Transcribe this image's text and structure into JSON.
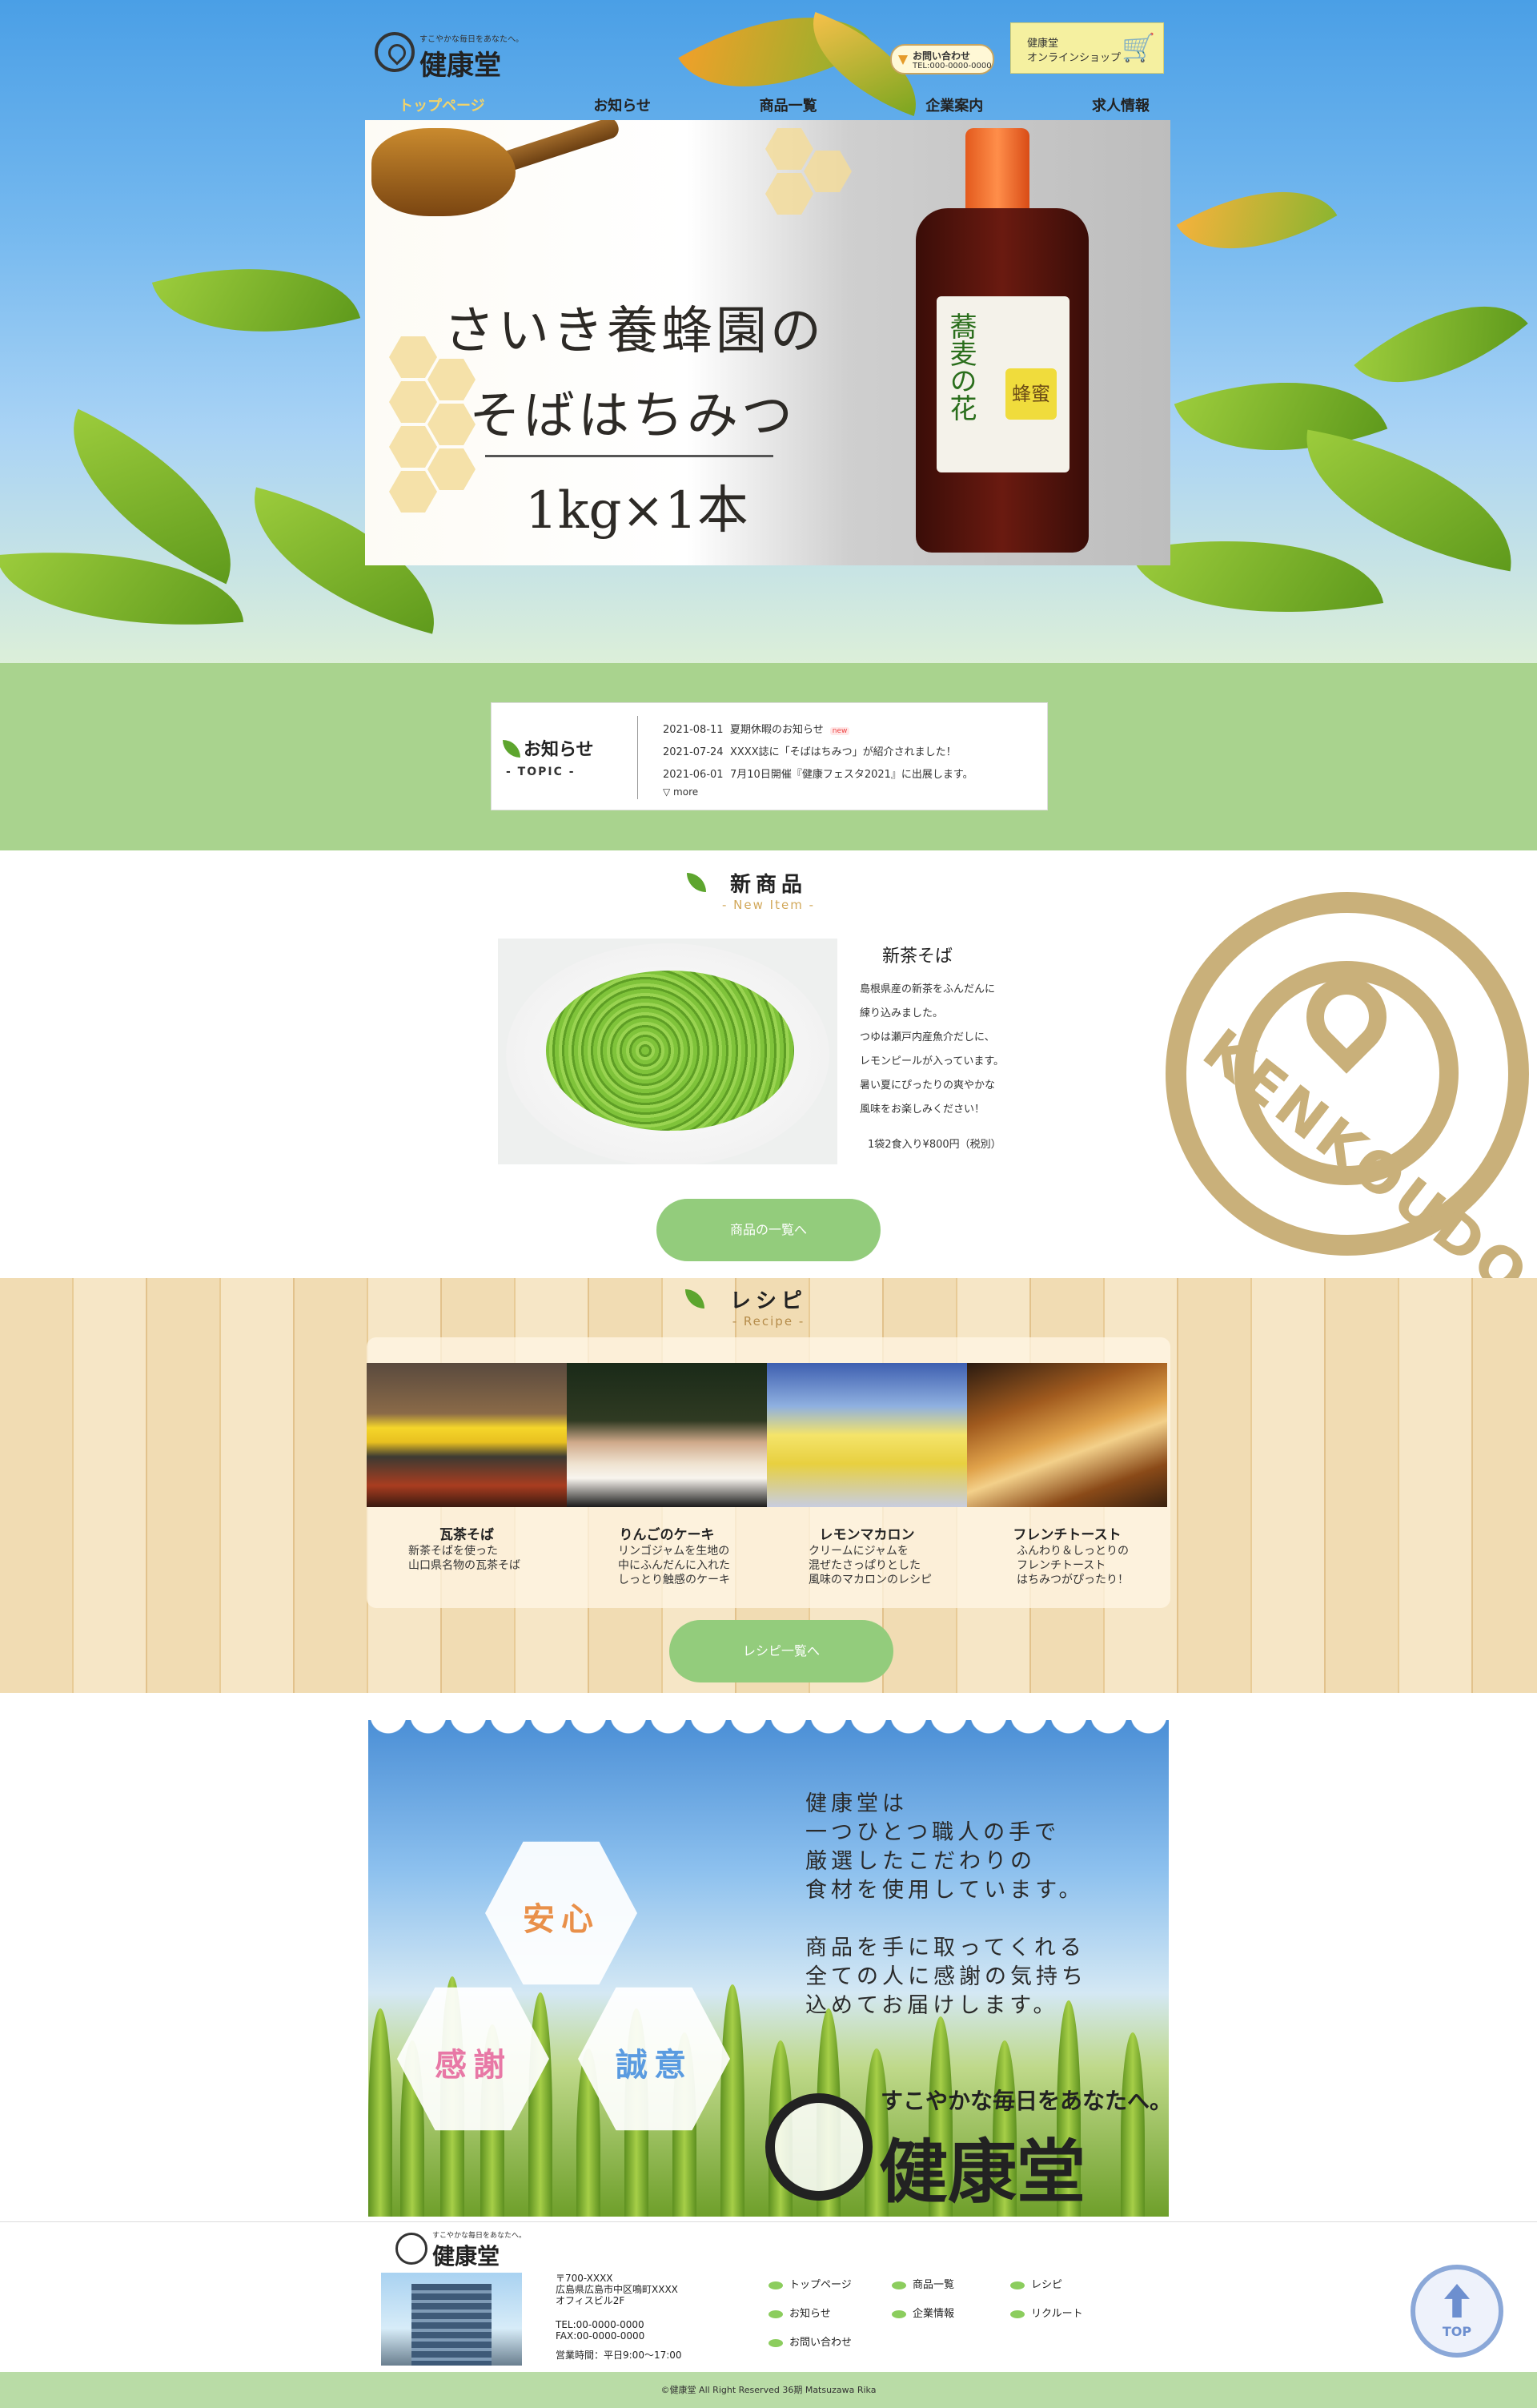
{
  "header": {
    "logo_tagline": "すこやかな毎日をあなたへ。",
    "logo_name": "健康堂",
    "contact_line1": "お問い合わせ",
    "contact_line2": "TEL:000-0000-0000",
    "shop_line1": "健康堂",
    "shop_line2": "オンラインショップ",
    "nav": [
      {
        "label": "トップページ",
        "active": true
      },
      {
        "label": "お知らせ"
      },
      {
        "label": "商品一覧"
      },
      {
        "label": "企業案内"
      },
      {
        "label": "求人情報"
      }
    ]
  },
  "banner": {
    "line1": "さいき養蜂園の",
    "line2": "そばはちみつ",
    "line3": "1kg×1本",
    "label_main": "蕎麦の花",
    "label_sub": "蜂蜜"
  },
  "news": {
    "title": "お知らせ",
    "subtitle": "- TOPIC -",
    "items": [
      {
        "date": "2021-08-11",
        "text": "夏期休暇のお知らせ",
        "new": "new"
      },
      {
        "date": "2021-07-24",
        "text": "XXXX誌に「そばはちみつ」が紹介されました！"
      },
      {
        "date": "2021-06-01",
        "text": "7月10日開催『健康フェスタ2021』に出展します。"
      }
    ],
    "more": "▽ more"
  },
  "new_item": {
    "heading": "新商品",
    "heading_en": "- New Item -",
    "name": "新茶そば",
    "desc": [
      "島根県産の新茶をふんだんに",
      "練り込みました。",
      "つゆは瀬戸内産魚介だしに、",
      "レモンピールが入っています。",
      "暑い夏にぴったりの爽やかな",
      "風味をお楽しみください！"
    ],
    "price": "1袋2食入り¥800円（税別）",
    "button": "商品の一覧へ",
    "mark_text": "KENKOUDO"
  },
  "recipe": {
    "heading": "レシピ",
    "heading_en": "- Recipe -",
    "cards": [
      {
        "name": "瓦茶そば",
        "lines": [
          "新茶そばを使った",
          "山口県名物の瓦茶そば"
        ]
      },
      {
        "name": "りんごのケーキ",
        "lines": [
          "リンゴジャムを生地の",
          "中にふんだんに入れた",
          "しっとり触感のケーキ"
        ]
      },
      {
        "name": "レモンマカロン",
        "lines": [
          "クリームにジャムを",
          "混ぜたさっぱりとした",
          "風味のマカロンのレシピ"
        ]
      },
      {
        "name": "フレンチトースト",
        "lines": [
          "ふんわり＆しっとりの",
          "フレンチトースト",
          "はちみつがぴったり！"
        ]
      }
    ],
    "button": "レシピ一覧へ"
  },
  "philosophy": {
    "hex": [
      "安心",
      "感謝",
      "誠意"
    ],
    "hex_colors": [
      "#e9904a",
      "#e878a6",
      "#5a9be0"
    ],
    "lines": [
      "健康堂は",
      "一つひとつ職人の手で",
      "厳選したこだわりの",
      "食材を使用しています。",
      "",
      "商品を手に取ってくれる",
      "全ての人に感謝の気持ち",
      "込めてお届けします。"
    ],
    "logo_tagline": "すこやかな毎日をあなたへ。",
    "logo_name": "健康堂"
  },
  "footer": {
    "logo_tagline": "すこやかな毎日をあなたへ。",
    "logo_name": "健康堂",
    "address": [
      "〒700-XXXX",
      "広島県広島市中区鳴町XXXX",
      "オフィスビル2F",
      "",
      "TEL:00-0000-0000",
      "FAX:00-0000-0000",
      "",
      "営業時間：平日9:00～17:00"
    ],
    "links": [
      "トップページ",
      "お知らせ",
      "お問い合わせ",
      "商品一覧",
      "企業情報",
      "レシピ",
      "リクルート"
    ],
    "top": "TOP",
    "copyright": "©健康堂 All Right Reserved  36期 Matsuzawa Rika"
  }
}
